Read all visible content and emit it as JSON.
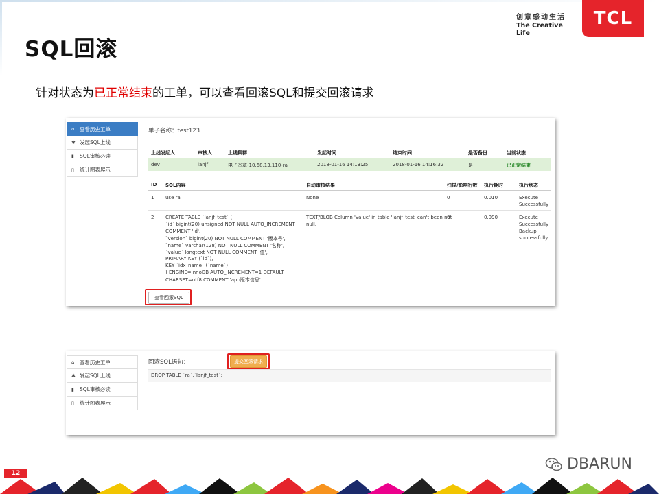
{
  "slide": {
    "title": "SQL回滚",
    "subtitle_pre": "针对状态为",
    "subtitle_highlight": "已正常结束",
    "subtitle_post": "的工单，可以查看回滚SQL和提交回滚请求",
    "tagline_cn": "创意感动生活",
    "tagline_en": "The Creative Life",
    "brand": "TCL",
    "page_number": "12",
    "watermark": "DBARUN",
    "colors": {
      "accent_red": "#e5242b",
      "nav_active": "#3b7dc4",
      "success_row": "#dff0d8",
      "submit": "#f0ad4e"
    }
  },
  "sidebar": {
    "items": [
      {
        "label": "查看历史工单",
        "icon": "home-icon"
      },
      {
        "label": "发起SQL上线",
        "icon": "asterisk-icon"
      },
      {
        "label": "SQL审核必读",
        "icon": "book-icon"
      },
      {
        "label": "统计图表展示",
        "icon": "file-icon"
      }
    ]
  },
  "panel1": {
    "order_name_label": "单子名称：",
    "order_name": "test123",
    "info_headers": [
      "上线发起人",
      "审核人",
      "上线集群",
      "发起时间",
      "结束时间",
      "是否备份",
      "当前状态"
    ],
    "info_row": [
      "dev",
      "lanjf",
      "电子签章-10.68.13.110-ra",
      "2018-01-16 14:13:25",
      "2018-01-16 14:16:32",
      "是",
      "已正常结束"
    ],
    "detail_headers": [
      "ID",
      "SQL内容",
      "自动审核结果",
      "扫描/影响行数",
      "执行耗时",
      "执行状态"
    ],
    "rows": [
      {
        "id": "1",
        "sql": [
          "use ra"
        ],
        "result": [
          "None"
        ],
        "rows": "0",
        "time": "0.010",
        "status": [
          "Execute",
          "Successfully"
        ]
      },
      {
        "id": "2",
        "sql": [
          "CREATE TABLE `lanjf_test` (",
          "  `id` bigint(20) unsigned NOT NULL AUTO_INCREMENT",
          "COMMENT 'id',",
          "  `version` bigint(20) NOT NULL COMMENT '版本号',",
          "  `name` varchar(128) NOT NULL COMMENT '名称',",
          "  `value` longtext NOT NULL COMMENT '值',",
          "  PRIMARY KEY (`id`),",
          "  KEY `idx_name` (`name`)",
          ") ENGINE=InnoDB AUTO_INCREMENT=1 DEFAULT",
          "CHARSET=utf8 COMMENT 'app版本信息'"
        ],
        "result": [
          "TEXT/BLOB Column 'value' in table 'lanjf_test' can't been not",
          "null."
        ],
        "rows": "0",
        "time": "0.090",
        "status": [
          "Execute",
          "Successfully",
          "Backup",
          "successfully"
        ]
      }
    ],
    "view_rollback_button": "查看回滚SQL"
  },
  "panel2": {
    "rollback_label": "回滚SQL语句：",
    "submit_button": "提交回滚请求",
    "rollback_sql": "DROP TABLE `ra`.`lanjf_test`;"
  }
}
